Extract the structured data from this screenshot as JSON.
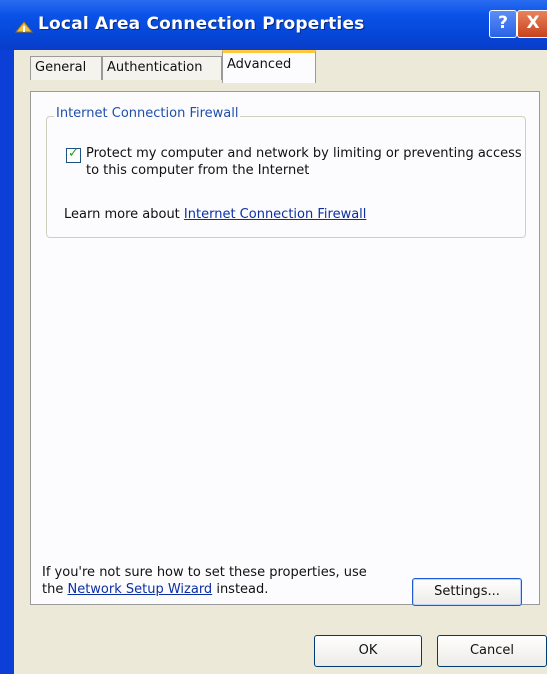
{
  "window": {
    "title": "Local Area Connection Properties",
    "help_label": "?",
    "close_label": "X"
  },
  "tabs": [
    {
      "label": "General"
    },
    {
      "label": "Authentication"
    },
    {
      "label": "Advanced"
    }
  ],
  "firewall": {
    "group_title": "Internet Connection Firewall",
    "checkbox_checked": true,
    "checkbox_label": "Protect my computer and network by limiting or preventing access to this computer from the Internet",
    "learn_prefix": "Learn more about ",
    "learn_link": "Internet Connection Firewall"
  },
  "footer": {
    "text_prefix": "If you're not sure how to set these properties, use the ",
    "wizard_link": "Network Setup Wizard",
    "text_suffix": " instead.",
    "settings_label": "Settings...",
    "ok_label": "OK",
    "cancel_label": "Cancel"
  },
  "colors": {
    "title_bar": "#0a52e8",
    "dialog_bg": "#ece9d8",
    "active_tab_accent": "#ffc73c",
    "link": "#0b2fa3",
    "group_title": "#1f4fa8"
  }
}
